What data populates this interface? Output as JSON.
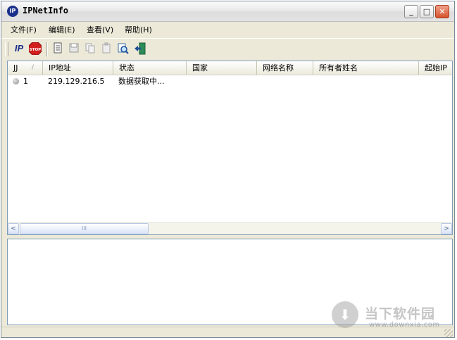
{
  "window": {
    "title": "IPNetInfo",
    "icon_text": "IP",
    "minimize": "_",
    "maximize": "□",
    "close": "✕"
  },
  "menu": [
    {
      "label": "文件(F)"
    },
    {
      "label": "编辑(E)"
    },
    {
      "label": "查看(V)"
    },
    {
      "label": "帮助(H)"
    }
  ],
  "toolbar": {
    "ip_label": "IP",
    "stop_label": "STOP"
  },
  "listview": {
    "columns": [
      "JJ",
      "IP地址",
      "状态",
      "国家",
      "网络名称",
      "所有者姓名",
      "起始IP"
    ],
    "rows": [
      {
        "index": "1",
        "ip": "219.129.216.5",
        "status": "数据获取中..."
      }
    ],
    "scroll_left": "<",
    "scroll_right": ">",
    "scroll_thumb": "III"
  },
  "watermark": {
    "text": "当下软件园",
    "url": "www.downxia.com"
  },
  "colors": {
    "accent_close": "#d5512d",
    "list_border": "#7f9db9",
    "window_bg": "#ece9d8"
  }
}
